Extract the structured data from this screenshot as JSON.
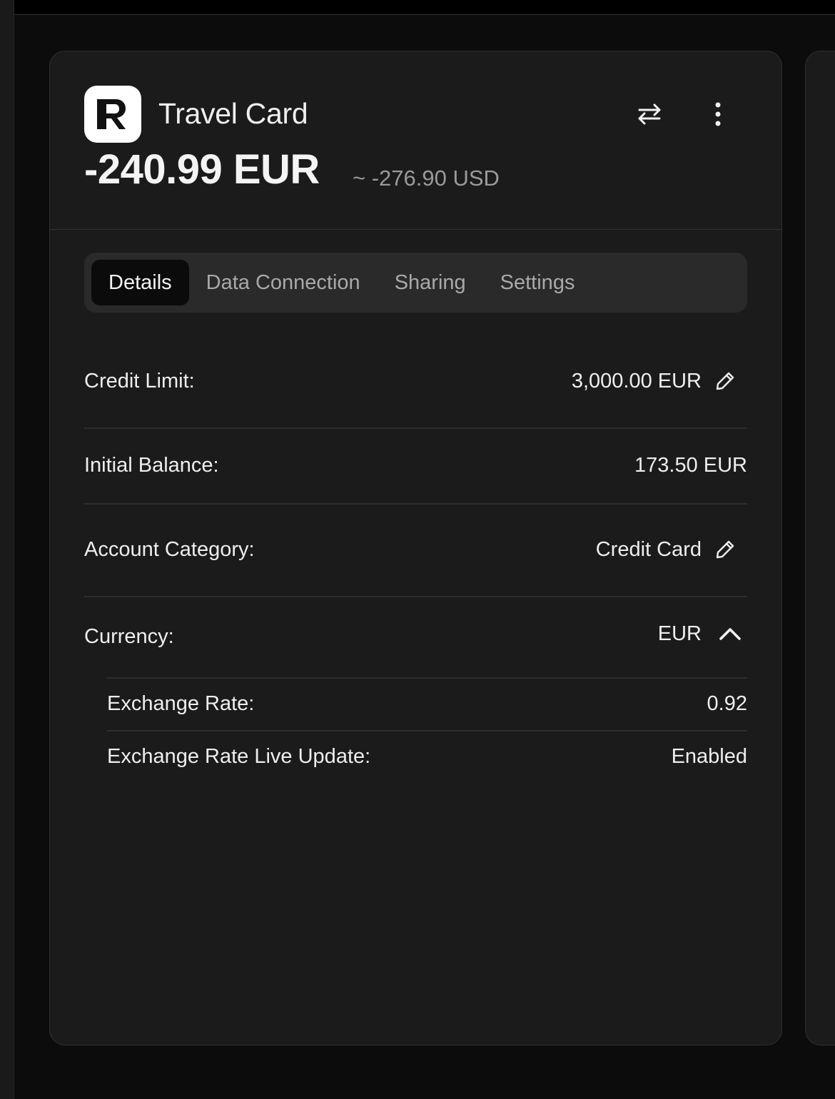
{
  "account": {
    "name": "Travel Card",
    "balance": "-240.99 EUR",
    "converted_balance": "~ -276.90 USD"
  },
  "tabs": [
    {
      "label": "Details",
      "active": true
    },
    {
      "label": "Data Connection",
      "active": false
    },
    {
      "label": "Sharing",
      "active": false
    },
    {
      "label": "Settings",
      "active": false
    }
  ],
  "details": {
    "credit_limit": {
      "label": "Credit Limit:",
      "value": "3,000.00 EUR"
    },
    "initial_balance": {
      "label": "Initial Balance:",
      "value": "173.50 EUR"
    },
    "account_category": {
      "label": "Account Category:",
      "value": "Credit Card"
    },
    "currency": {
      "label": "Currency:",
      "value": "EUR",
      "expanded": true
    },
    "exchange_rate": {
      "label": "Exchange Rate:",
      "value": "0.92"
    },
    "exchange_rate_live_update": {
      "label": "Exchange Rate Live Update:",
      "value": "Enabled"
    }
  },
  "icons": {
    "logo": "revolut-logo-icon",
    "transfer": "arrows-swap-icon",
    "more": "more-vertical-icon",
    "edit": "pencil-icon",
    "collapse": "chevron-up-icon"
  },
  "colors": {
    "background": "#0c0c0c",
    "card": "#1b1b1b",
    "tab_bar": "#2a2a2a",
    "tab_active": "#0b0b0b",
    "muted_text": "#9a9a9a"
  }
}
